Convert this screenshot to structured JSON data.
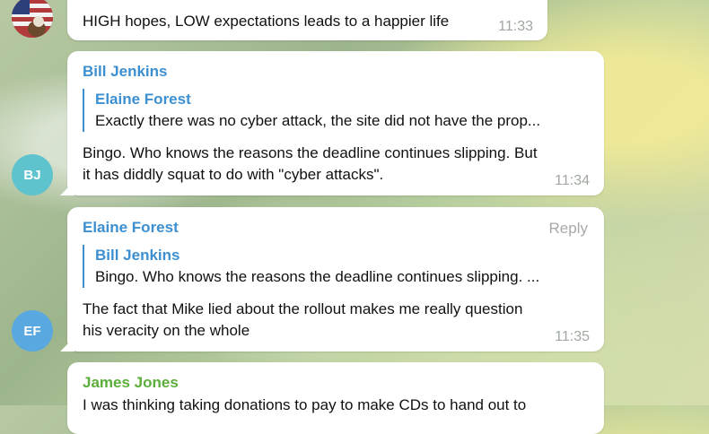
{
  "messages": [
    {
      "text": "HIGH hopes, LOW expectations leads to a happier life",
      "time": "11:33"
    },
    {
      "sender": "Bill Jenkins",
      "quote": {
        "name": "Elaine Forest",
        "text": "Exactly there was no cyber attack, the site did not have the prop..."
      },
      "line1": "Bingo. Who knows the reasons the deadline continues slipping. But",
      "line2": "it has diddly squat to do with \"cyber attacks\".",
      "time": "11:34",
      "avatar": "BJ",
      "avatar_color": "#5ec3cc"
    },
    {
      "sender": "Elaine Forest",
      "reply_label": "Reply",
      "quote": {
        "name": "Bill Jenkins",
        "text": "Bingo. Who knows the reasons the deadline continues slipping. ..."
      },
      "line1": "The fact that Mike lied about the rollout makes me really question",
      "line2": "his veracity on the whole",
      "time": "11:35",
      "avatar": "EF",
      "avatar_color": "#5aa8e0"
    },
    {
      "sender": "James Jones",
      "line1": "I was thinking taking donations to pay to make CDs to hand out to"
    }
  ],
  "colors": {
    "sender_blue": "#3c8fd0",
    "sender_green": "#5cae3a",
    "timestamp": "#a0a8a0"
  }
}
